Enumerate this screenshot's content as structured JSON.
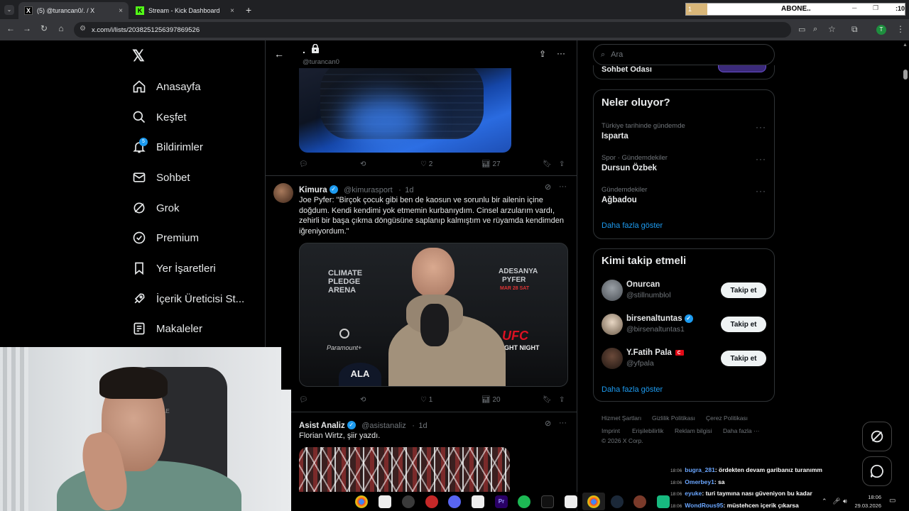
{
  "browser": {
    "tabs": [
      {
        "label": "(5) @turancan0/. / X",
        "close": "×"
      },
      {
        "label": "Stream - Kick Dashboard",
        "close": "×"
      }
    ],
    "new_tab": "+",
    "url": "x.com/i/lists/2038251256397869526",
    "abone_badge": "ABONE..",
    "abone_count": "1",
    "clock_frag": ":10",
    "profile_initial": "T"
  },
  "sidebar": {
    "logo": "𝕏",
    "notif_count": "5",
    "items": [
      {
        "label": "Anasayfa"
      },
      {
        "label": "Keşfet"
      },
      {
        "label": "Bildirimler"
      },
      {
        "label": "Sohbet"
      },
      {
        "label": "Grok"
      },
      {
        "label": "Premium"
      },
      {
        "label": "Yer İşaretleri"
      },
      {
        "label": "İçerik Üreticisi St..."
      },
      {
        "label": "Makaleler"
      }
    ]
  },
  "header": {
    "title": ".",
    "handle": "@turancan0"
  },
  "tweets": [
    {
      "reply": "",
      "retweet": "",
      "likes": "2",
      "views": "27"
    },
    {
      "name": "Kimura",
      "handle": "@kimurasport",
      "time": "1d",
      "text": "Joe Pyfer: \"Birçok çocuk gibi ben de kaosun ve sorunlu bir ailenin içine doğdum. Kendi kendimi yok etmemin kurbanıydım. Cinsel arzularım vardı, zehirli bir başa çıkma döngüsüne saplanıp kalmıştım ve rüyamda kendimden iğreniyordum.\"",
      "likes": "1",
      "views": "20",
      "media": {
        "left_sign": "CLIMATE PLEDGE ARENA",
        "right_sign_1": "ADESANYA",
        "right_sign_2": "PYFER",
        "right_sign_3": "MAR 28 SAT",
        "ufc": "UFC",
        "fight_night": "FIGHT NIGHT",
        "paramount": "Paramount+",
        "cap": "ALA"
      }
    },
    {
      "name": "Asist Analiz",
      "handle": "@asistanaliz",
      "time": "1d",
      "text": "Florian Wirtz, şiir yazdı."
    }
  ],
  "right": {
    "search_placeholder": "Ara",
    "partial_card": "Sohbet Odası",
    "trends_title": "Neler oluyor?",
    "trends": [
      {
        "meta": "Türkiye tarihinde gündemde",
        "name": "Isparta"
      },
      {
        "meta": "Spor · Gündemdekiler",
        "name": "Dursun Özbek"
      },
      {
        "meta": "Gündemdekiler",
        "name": "Ağbadou"
      }
    ],
    "show_more": "Daha fazla göster",
    "follow_title": "Kimi takip etmeli",
    "follow": [
      {
        "name": "Onurcan",
        "handle": "@stillnumblol"
      },
      {
        "name": "birsenaltuntas",
        "handle": "@birsenaltuntas1"
      },
      {
        "name": "Y.Fatih Pala",
        "handle": "@yfpala"
      }
    ],
    "follow_button": "Takip et",
    "follow_more": "Daha fazla göster",
    "footer": [
      "Hizmet Şartları",
      "Gizlilik Politikası",
      "Çerez Politikası",
      "Imprint",
      "Erişilebilirlik",
      "Reklam bilgisi",
      "Daha fazla ···"
    ],
    "copyright": "© 2026 X Corp."
  },
  "chat": [
    {
      "time": "18:06",
      "user": "bugra_281",
      "msg": ": ördekten devam garibanız turanımm"
    },
    {
      "time": "18:06",
      "user": "Omerbey1",
      "msg": ": sa"
    },
    {
      "time": "18:06",
      "user": "eyuke",
      "msg": ": turi taymına nası güveniyon bu kadar"
    },
    {
      "time": "18:06",
      "user": "WondRous95",
      "msg": ": müstehcen içerik çıkarsa"
    }
  ],
  "taskbar": {
    "time": "18:06",
    "date": "29.03.2026"
  },
  "webcam": {
    "chair_text": "AE"
  },
  "colors": {
    "accent": "#1d9bf0",
    "bg": "#000000",
    "border": "#2f3336",
    "muted": "#71767b"
  }
}
